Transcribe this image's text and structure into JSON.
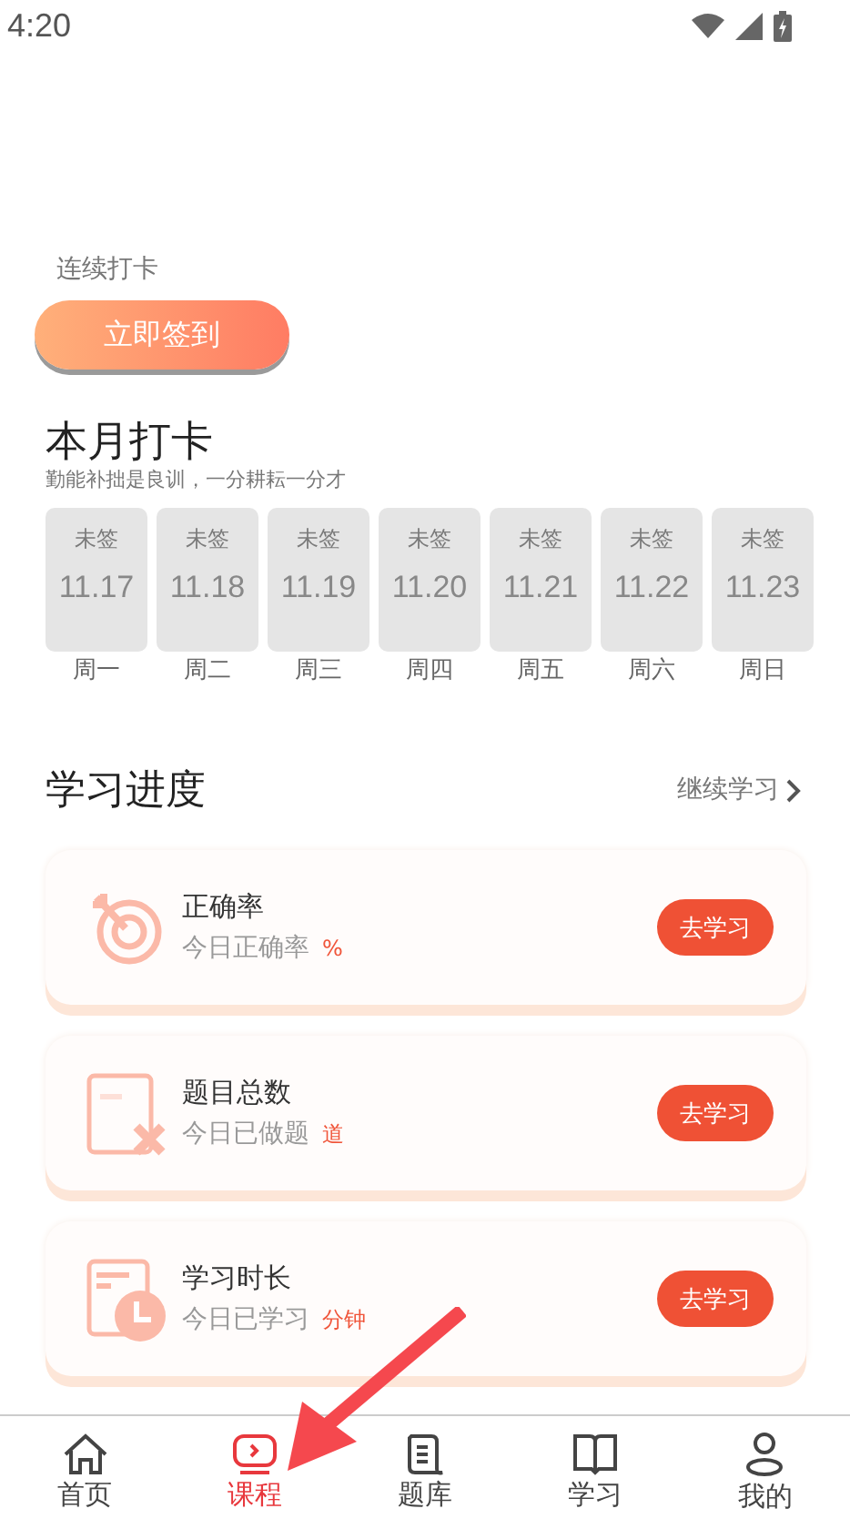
{
  "status_bar": {
    "time": "4:20"
  },
  "checkin": {
    "streak_label": "连续打卡",
    "button": "立即签到"
  },
  "month": {
    "title": "本月打卡",
    "motto": "勤能补拙是良训，一分耕耘一分才",
    "days": [
      {
        "status": "未签",
        "date": "11.17",
        "weekday": "周一",
        "signed": false
      },
      {
        "status": "未签",
        "date": "11.18",
        "weekday": "周二",
        "signed": false
      },
      {
        "status": "未签",
        "date": "11.19",
        "weekday": "周三",
        "signed": false
      },
      {
        "status": "未签",
        "date": "11.20",
        "weekday": "周四",
        "signed": false
      },
      {
        "status": "未签",
        "date": "11.21",
        "weekday": "周五",
        "signed": false
      },
      {
        "status": "未签",
        "date": "11.22",
        "weekday": "周六",
        "signed": false
      },
      {
        "status": "未签",
        "date": "11.23",
        "weekday": "周日",
        "signed": false
      }
    ]
  },
  "progress": {
    "title": "学习进度",
    "link": "继续学习",
    "cards": [
      {
        "kind": "accuracy",
        "title": "正确率",
        "caption": "今日正确率",
        "unit": "%",
        "button": "去学习"
      },
      {
        "kind": "questions",
        "title": "题目总数",
        "caption": "今日已做题",
        "unit": "道",
        "button": "去学习"
      },
      {
        "kind": "time",
        "title": "学习时长",
        "caption": "今日已学习",
        "unit": "分钟",
        "button": "去学习"
      }
    ]
  },
  "tabs": [
    {
      "kind": "home",
      "label": "首页",
      "selected": false
    },
    {
      "kind": "course",
      "label": "课程",
      "selected": true
    },
    {
      "kind": "bank",
      "label": "题库",
      "selected": false
    },
    {
      "kind": "study",
      "label": "学习",
      "selected": false
    },
    {
      "kind": "mine",
      "label": "我的",
      "selected": false
    }
  ]
}
